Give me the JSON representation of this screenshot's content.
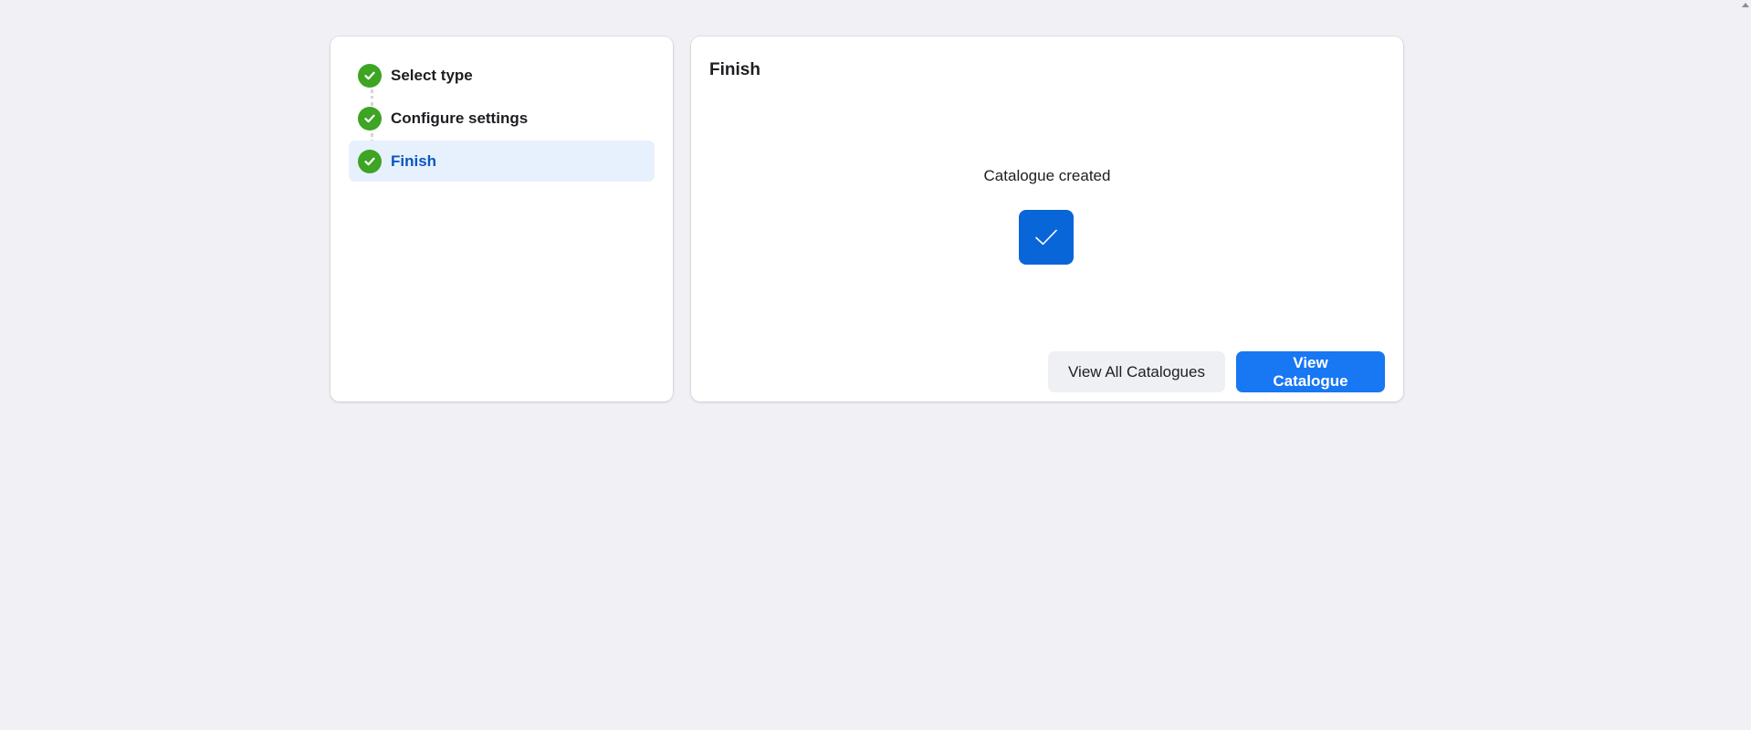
{
  "wizard": {
    "steps": [
      {
        "label": "Select type",
        "status": "complete"
      },
      {
        "label": "Configure settings",
        "status": "complete"
      },
      {
        "label": "Finish",
        "status": "complete",
        "active": true
      }
    ]
  },
  "main": {
    "title": "Finish",
    "success_message": "Catalogue created",
    "icon": "checkmark-icon"
  },
  "actions": {
    "view_all_label": "View All Catalogues",
    "view_catalogue_label": "View Catalogue"
  },
  "colors": {
    "page_background": "#f1f0f4",
    "step_complete": "#3ea424",
    "active_step_bg": "#e7f0fd",
    "active_step_text": "#0a55c1",
    "success_box": "#0866d8",
    "primary_button": "#1877f2",
    "secondary_button": "#eef0f3"
  }
}
